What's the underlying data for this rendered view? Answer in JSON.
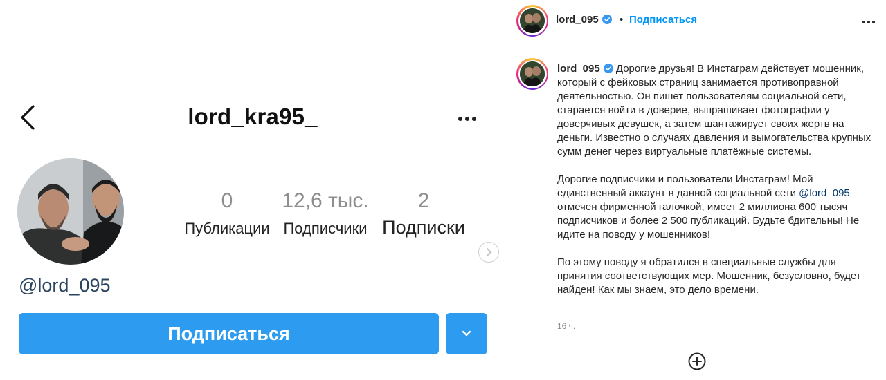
{
  "profile_screenshot": {
    "username": "lord_kra95_",
    "stats": [
      {
        "value": "0",
        "label": "Публикации"
      },
      {
        "value": "12,6 тыс.",
        "label": "Подписчики"
      },
      {
        "value": "2",
        "label": "Подписки"
      }
    ],
    "handle": "@lord_095",
    "follow_button": "Подписаться",
    "icons": [
      "chevron-left-icon",
      "more-horizontal-icon",
      "chevron-right-icon",
      "chevron-down-icon"
    ]
  },
  "post": {
    "header": {
      "username": "lord_095",
      "separator": "•",
      "follow_label": "Подписаться"
    },
    "caption": {
      "username": "lord_095",
      "paragraph1": "Дорогие друзья! В Инстаграм действует мошенник, который с фейковых страниц занимается противоправной деятельностью. Он пишет пользователям социальной сети, старается войти в доверие, выпрашивает фотографии у доверчивых девушек, а затем шантажирует своих жертв на деньги. Известно о случаях давления и вымогательства крупных сумм денег через виртуальные платёжные системы.",
      "paragraph2_before": "Дорогие подписчики и пользователи Инстаграм! Мой единственный аккаунт в данной социальной сети ",
      "paragraph2_mention": "@lord_095",
      "paragraph2_after": " отмечен фирменной галочкой, имеет 2 миллиона 600 тысяч подписчиков и более 2 500 публикаций. Будьте бдительны! Не идите на поводу у мошенников!",
      "paragraph3": "По этому поводу я обратился в специальные службы для принятия соответствующих мер. Мошенник, безусловно, будет найден! Как мы знаем, это дело времени."
    },
    "timestamp": "16 ч.",
    "icons": [
      "verified-badge-icon",
      "more-horizontal-icon",
      "add-comment-icon"
    ]
  },
  "colors": {
    "accent": "#0095f6",
    "follow_button": "#2c9bf0",
    "mention": "#00376b",
    "muted": "#8e8e8e"
  }
}
